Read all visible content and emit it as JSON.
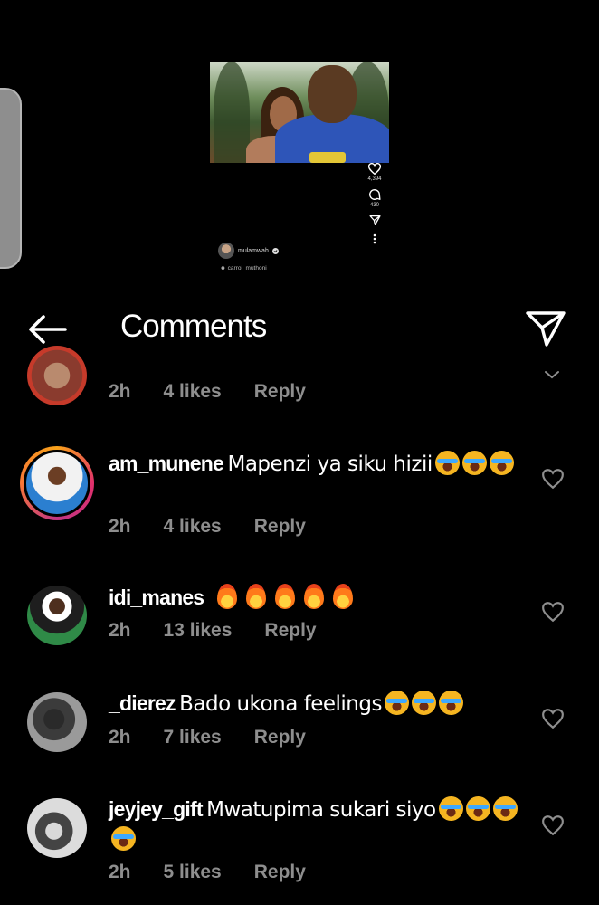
{
  "reel": {
    "likes_count": "4,394",
    "comments_count": "430",
    "author": "mulamwah",
    "collaborator": "carrol_muthoni"
  },
  "header": {
    "title": "Comments"
  },
  "comments": [
    {
      "username": "",
      "text": "",
      "time": "2h",
      "likes": "4 likes",
      "reply": "Reply"
    },
    {
      "username": "am_munene",
      "text": "Mapenzi ya siku hizii",
      "emoji_count": 3,
      "time": "2h",
      "likes": "4 likes",
      "reply": "Reply"
    },
    {
      "username": "idi_manes",
      "text": "",
      "emoji": "🔥🔥🔥🔥🔥",
      "time": "2h",
      "likes": "13 likes",
      "reply": "Reply"
    },
    {
      "username": "_dierez",
      "text": "Bado ukona feelings",
      "emoji_count": 3,
      "time": "2h",
      "likes": "7 likes",
      "reply": "Reply"
    },
    {
      "username": "jeyjey_gift",
      "text": "Mwatupima sukari siyo",
      "emoji_count": 4,
      "time": "2h",
      "likes": "5 likes",
      "reply": "Reply"
    }
  ],
  "icons": {
    "back": "arrow-left-icon",
    "share": "paper-plane-icon",
    "like": "heart-outline-icon",
    "laugh": "face-with-tears-of-joy",
    "fire": "fire"
  },
  "colors": {
    "background": "#000000",
    "meta_text": "#8e8e8e",
    "story_ring": "#e1306c"
  }
}
